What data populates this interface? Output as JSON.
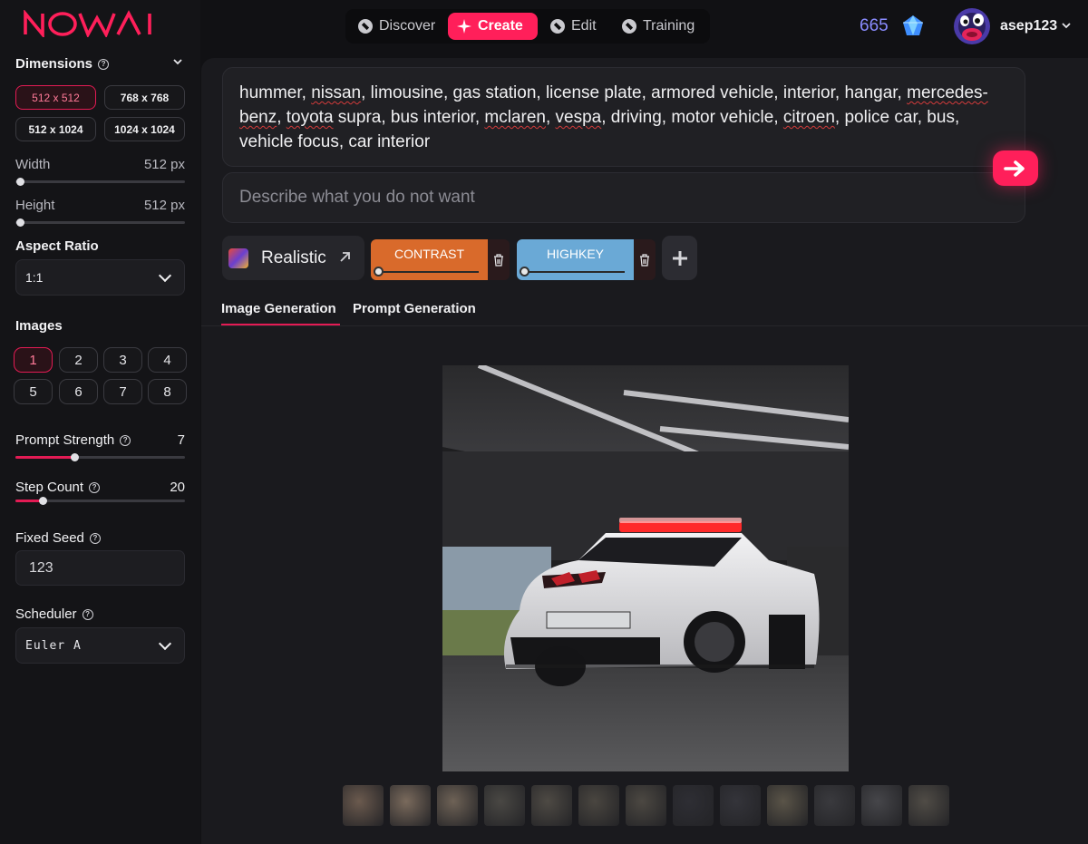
{
  "app": {
    "logo_text": "NOWAI"
  },
  "nav": {
    "items": [
      {
        "label": "Discover"
      },
      {
        "label": "Create"
      },
      {
        "label": "Edit"
      },
      {
        "label": "Training"
      }
    ],
    "active": "Create"
  },
  "account": {
    "credits": "665",
    "username": "asep123"
  },
  "sidebar": {
    "dimensions": {
      "label": "Dimensions",
      "options": [
        "512 x 512",
        "768 x 768",
        "512 x 1024",
        "1024 x 1024"
      ],
      "selected": "512 x 512"
    },
    "width": {
      "label": "Width",
      "value": "512 px"
    },
    "height": {
      "label": "Height",
      "value": "512 px"
    },
    "aspect_ratio": {
      "label": "Aspect Ratio",
      "value": "1:1"
    },
    "images": {
      "label": "Images",
      "options": [
        "1",
        "2",
        "3",
        "4",
        "5",
        "6",
        "7",
        "8"
      ],
      "selected": "1"
    },
    "prompt_strength": {
      "label": "Prompt Strength",
      "value": "7",
      "level": 0.35
    },
    "step_count": {
      "label": "Step Count",
      "value": "20",
      "level": 0.16
    },
    "fixed_seed": {
      "label": "Fixed Seed",
      "value": "123"
    },
    "scheduler": {
      "label": "Scheduler",
      "value": "Euler A"
    }
  },
  "prompt": {
    "parts": [
      {
        "text": "hummer, "
      },
      {
        "text": "nissan",
        "misspelled": true
      },
      {
        "text": ", limousine, gas station, license plate, armored vehicle, interior, hangar, "
      },
      {
        "text": "mercedes-benz",
        "misspelled": true
      },
      {
        "text": ", "
      },
      {
        "text": "toyota",
        "misspelled": true
      },
      {
        "text": " supra, bus interior, "
      },
      {
        "text": "mclaren",
        "misspelled": true
      },
      {
        "text": ", "
      },
      {
        "text": "vespa",
        "misspelled": true
      },
      {
        "text": ", driving, motor vehicle, "
      },
      {
        "text": "citroen",
        "misspelled": true
      },
      {
        "text": ", police car, bus, vehicle focus, car interior"
      }
    ],
    "negative_placeholder": "Describe what you do not want"
  },
  "style": {
    "name": "Realistic"
  },
  "loras": [
    {
      "label": "CONTRAST",
      "color": "#d96a2b",
      "level": 0.0
    },
    {
      "label": "HIGHKEY",
      "color": "#6aa9d6",
      "level": 0.0
    }
  ],
  "tabs": [
    {
      "label": "Image Generation",
      "active": true
    },
    {
      "label": "Prompt Generation",
      "active": false
    }
  ],
  "history_thumbnails": 13,
  "colors": {
    "accent": "#ff1f5a",
    "credits": "#8a8cff"
  }
}
